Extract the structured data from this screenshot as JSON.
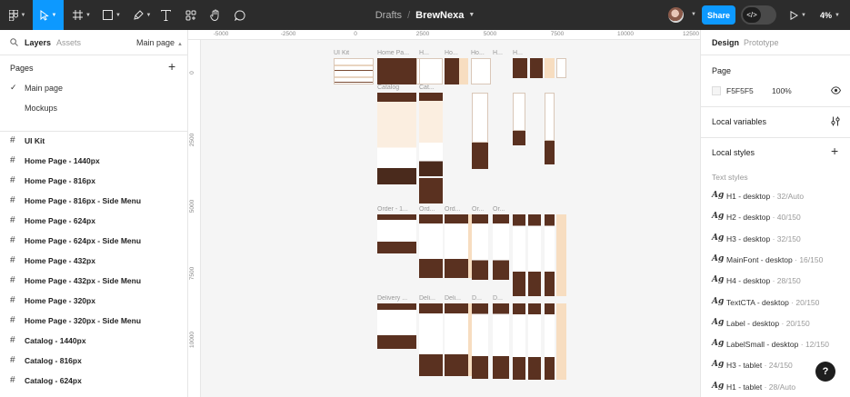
{
  "toolbar": {
    "breadcrumb_drafts": "Drafts",
    "breadcrumb_sep": "/",
    "file_name": "BrewNexa",
    "share_label": "Share",
    "devmode_label": "</>",
    "zoom": "4%",
    "accent": "#0d99ff"
  },
  "left_panel": {
    "tab_layers": "Layers",
    "tab_assets": "Assets",
    "page_selector": "Main page",
    "pages_heading": "Pages",
    "pages": [
      {
        "label": "Main page",
        "selected": true
      },
      {
        "label": "Mockups",
        "selected": false
      }
    ],
    "layers": [
      "UI Kit",
      "Home Page - 1440px",
      "Home Page - 816px",
      "Home Page - 816px - Side Menu",
      "Home Page - 624px",
      "Home Page - 624px - Side Menu",
      "Home Page - 432px",
      "Home Page - 432px - Side Menu",
      "Home Page - 320px",
      "Home Page - 320px - Side Menu",
      "Catalog - 1440px",
      "Catalog - 816px",
      "Catalog - 624px"
    ]
  },
  "canvas": {
    "ruler_top": [
      "-5000",
      "-2500",
      "0",
      "2500",
      "5000",
      "7500",
      "10000",
      "12500"
    ],
    "ruler_left": [
      "0",
      "2500",
      "5000",
      "7500",
      "10000"
    ],
    "labels": {
      "ui_kit": "UI Kit",
      "home1": "Home Pa...",
      "home2": "H...",
      "home3": "Ho...",
      "home4": "Ho...",
      "home5": "H...",
      "home6": "H...",
      "catalog1": "Catalog",
      "catalog2": "Cat...",
      "order1": "Order - 1...",
      "order2": "Ord...",
      "order3": "Ord...",
      "order4": "Or...",
      "order5": "Or...",
      "delivery1": "Delivery ...",
      "delivery2": "Deli...",
      "delivery3": "Deli...",
      "delivery4": "D...",
      "delivery5": "D..."
    }
  },
  "right_panel": {
    "tab_design": "Design",
    "tab_prototype": "Prototype",
    "page_heading": "Page",
    "page_color": "F5F5F5",
    "page_opacity": "100%",
    "local_variables": "Local variables",
    "local_styles": "Local styles",
    "text_styles_heading": "Text styles",
    "text_styles": [
      {
        "name": "H1 - desktop",
        "meta": "32/Auto",
        "icon": "Ag"
      },
      {
        "name": "H2 - desktop",
        "meta": "40/150",
        "icon": "Ag"
      },
      {
        "name": "H3 - desktop",
        "meta": "32/150",
        "icon": "Ag"
      },
      {
        "name": "MainFont - desktop",
        "meta": "16/150",
        "icon": "Ag"
      },
      {
        "name": "H4 - desktop",
        "meta": "28/150",
        "icon": "Ag"
      },
      {
        "name": "TextCTA - desktop",
        "meta": "20/150",
        "icon": "Ag"
      },
      {
        "name": "Label - desktop",
        "meta": "20/150",
        "icon": "Ag"
      },
      {
        "name": "LabelSmall - desktop",
        "meta": "12/150",
        "icon": "Ag"
      },
      {
        "name": "H3 - tablet",
        "meta": "24/150",
        "icon": "Ag"
      },
      {
        "name": "H1 - tablet",
        "meta": "28/Auto",
        "icon": "Ag"
      }
    ],
    "help_label": "?"
  }
}
